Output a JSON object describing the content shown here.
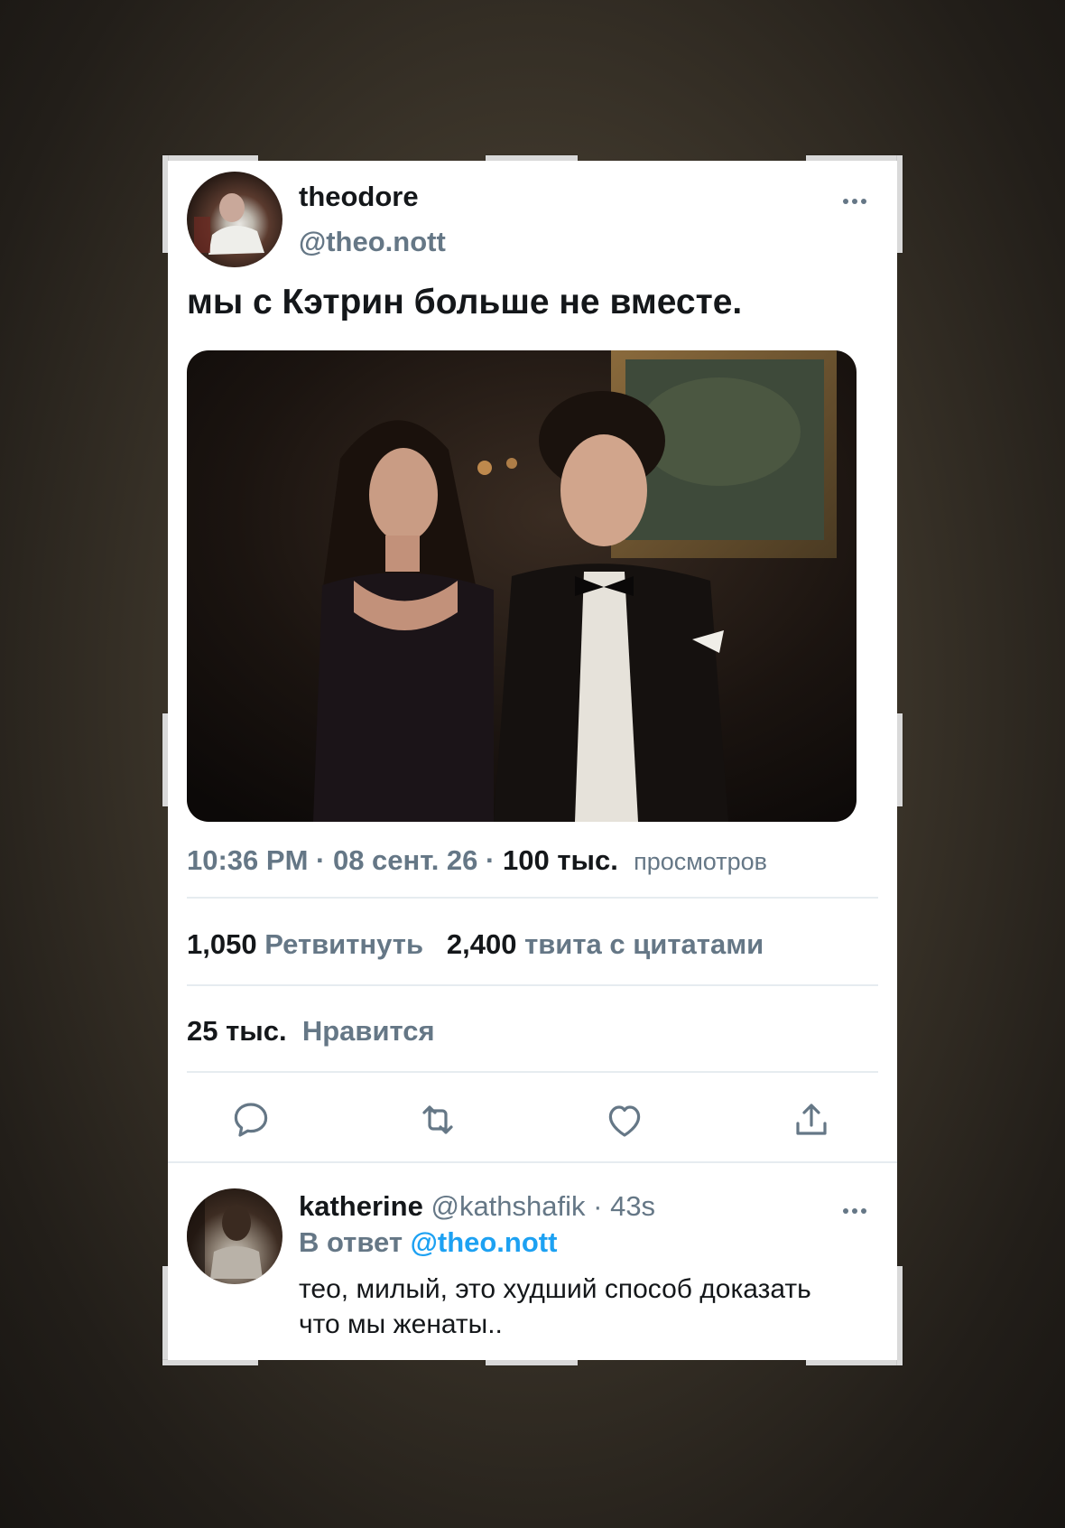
{
  "tweet": {
    "author_name": "theodore",
    "author_handle": "@theo.nott",
    "more_icon": "more-horizontal-icon",
    "text": "мы с Кэтрин больше не вместе.",
    "time": "10:36 PM · 08 сент. 26",
    "sep": " · ",
    "views_count": "100 тыс.",
    "views_label": "просмотров",
    "retweets_count": "1,050",
    "retweets_label": "Ретвитнуть",
    "quotes_count": "2,400",
    "quotes_label": "твита с цитатами",
    "likes_count": "25 тыс.",
    "likes_label": "Нравится"
  },
  "actions": [
    "reply-icon",
    "retweet-icon",
    "like-icon",
    "share-icon"
  ],
  "reply": {
    "author_name": "katherine",
    "author_handle": "@kathshafik",
    "time": "· 43s",
    "reply_prefix": "В ответ",
    "mention": "@theo.nott",
    "text": "тео, милый, это худший способ доказать что мы женаты.."
  },
  "colors": {
    "accent": "#1da1f2",
    "secondary_text": "#657786",
    "primary_text": "#14171a"
  }
}
